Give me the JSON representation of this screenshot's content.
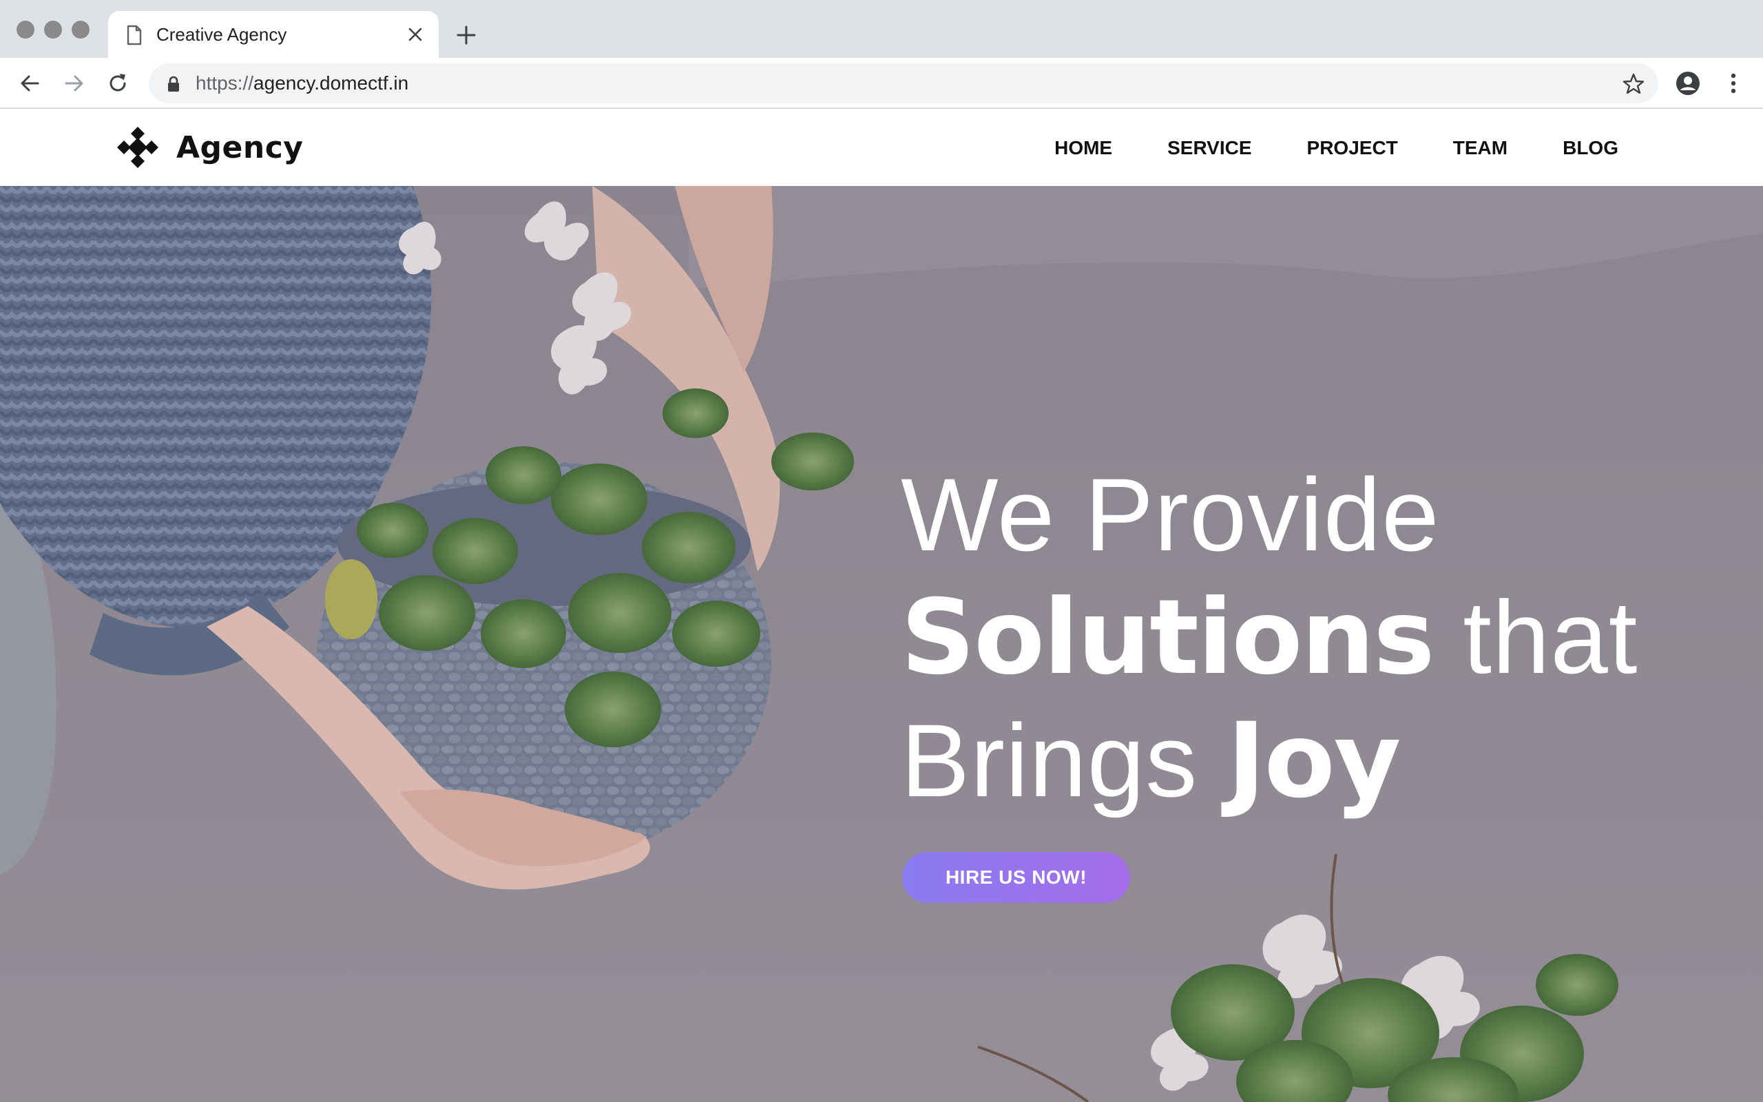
{
  "browser": {
    "tab": {
      "title": "Creative Agency",
      "page_icon": "page-icon",
      "close_icon": "close-icon"
    },
    "new_tab_icon": "plus-icon",
    "toolbar": {
      "back_icon": "arrow-left-icon",
      "forward_icon": "arrow-right-icon",
      "reload_icon": "reload-icon",
      "url_scheme": "https://",
      "url_host": "agency.domectf.in",
      "lock_icon": "lock-icon",
      "bookmark_icon": "star-icon",
      "profile_icon": "account-circle-icon",
      "menu_icon": "kebab-menu-icon"
    }
  },
  "site": {
    "brand": {
      "name": "Agency",
      "logo_icon": "four-diamond-logo-icon"
    },
    "nav": [
      {
        "label": "HOME"
      },
      {
        "label": "SERVICE"
      },
      {
        "label": "PROJECT"
      },
      {
        "label": "TEAM"
      },
      {
        "label": "BLOG"
      }
    ],
    "hero": {
      "line1": "We Provide",
      "line2_bold": "Solutions",
      "line2_thin": " that",
      "line3_thin": "Brings ",
      "line3_bold": "Joy",
      "cta_label": "HIRE US NOW!"
    }
  },
  "colors": {
    "accent_gradient_start": "#8a7cf0",
    "accent_gradient_end": "#a46de8",
    "hero_tint": "#948e97",
    "chrome_tabstrip": "#dee1e6"
  }
}
